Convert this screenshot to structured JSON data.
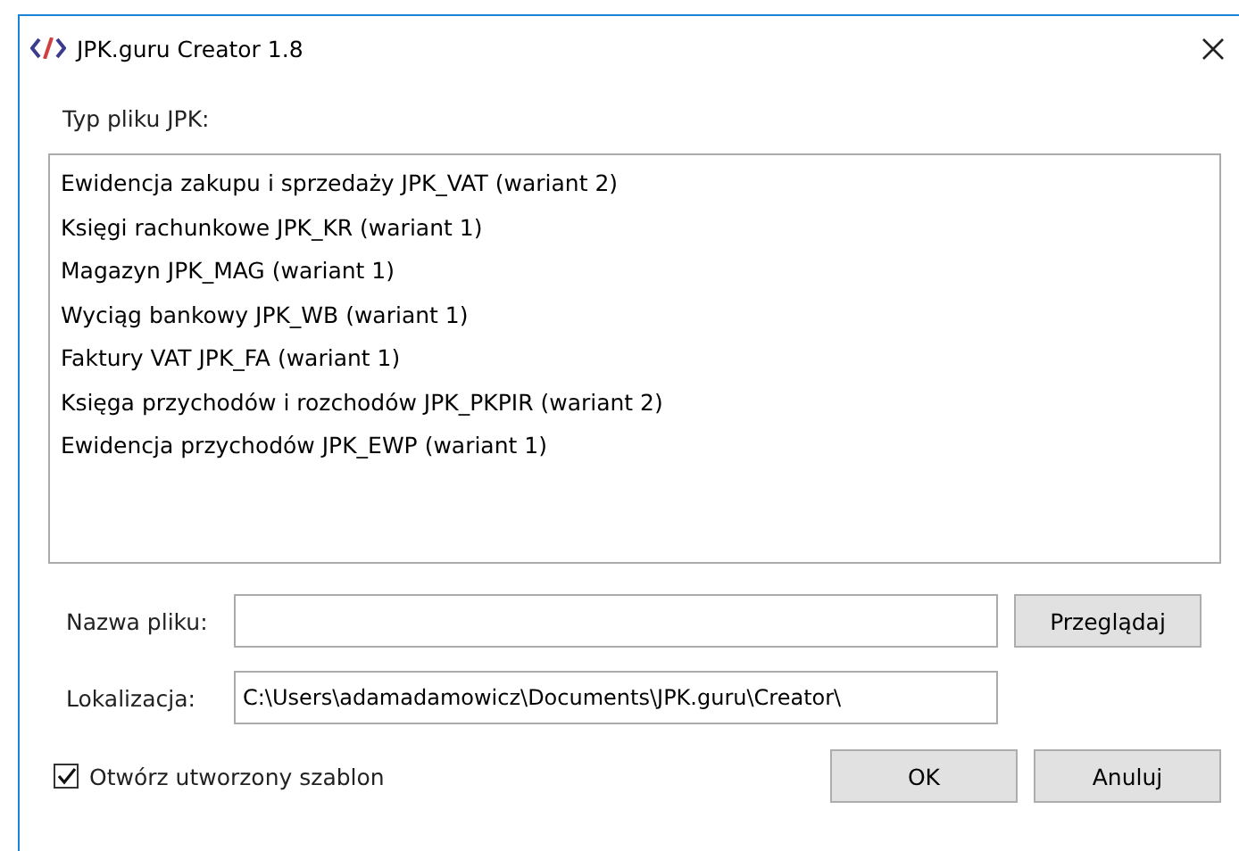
{
  "window": {
    "title": "JPK.guru Creator 1.8"
  },
  "file_type": {
    "label": "Typ pliku JPK:",
    "items": [
      {
        "label": "Ewidencja zakupu i sprzedaży JPK_VAT (wariant 2)",
        "selected": false
      },
      {
        "label": "Księgi rachunkowe JPK_KR (wariant 1)",
        "selected": false
      },
      {
        "label": "Magazyn JPK_MAG (wariant 1)",
        "selected": false
      },
      {
        "label": "Wyciąg bankowy JPK_WB (wariant 1)",
        "selected": false
      },
      {
        "label": "Faktury VAT JPK_FA (wariant 1)",
        "selected": false
      },
      {
        "label": "Księga przychodów i rozchodów JPK_PKPIR (wariant 2)",
        "selected": false
      },
      {
        "label": "Ewidencja przychodów JPK_EWP (wariant 1)",
        "selected": false
      }
    ]
  },
  "file_name": {
    "label": "Nazwa pliku:",
    "button": "Przeglądaj"
  },
  "location": {
    "label": "Lokalizacja:",
    "value": "C:\\Users\\adamadamowicz\\Documents\\JPK.guru\\Creator\\"
  },
  "open_template": {
    "label": "Otwórz utworzony szablon",
    "checked": true
  },
  "buttons": [
    "OK",
    "Anuluj"
  ]
}
